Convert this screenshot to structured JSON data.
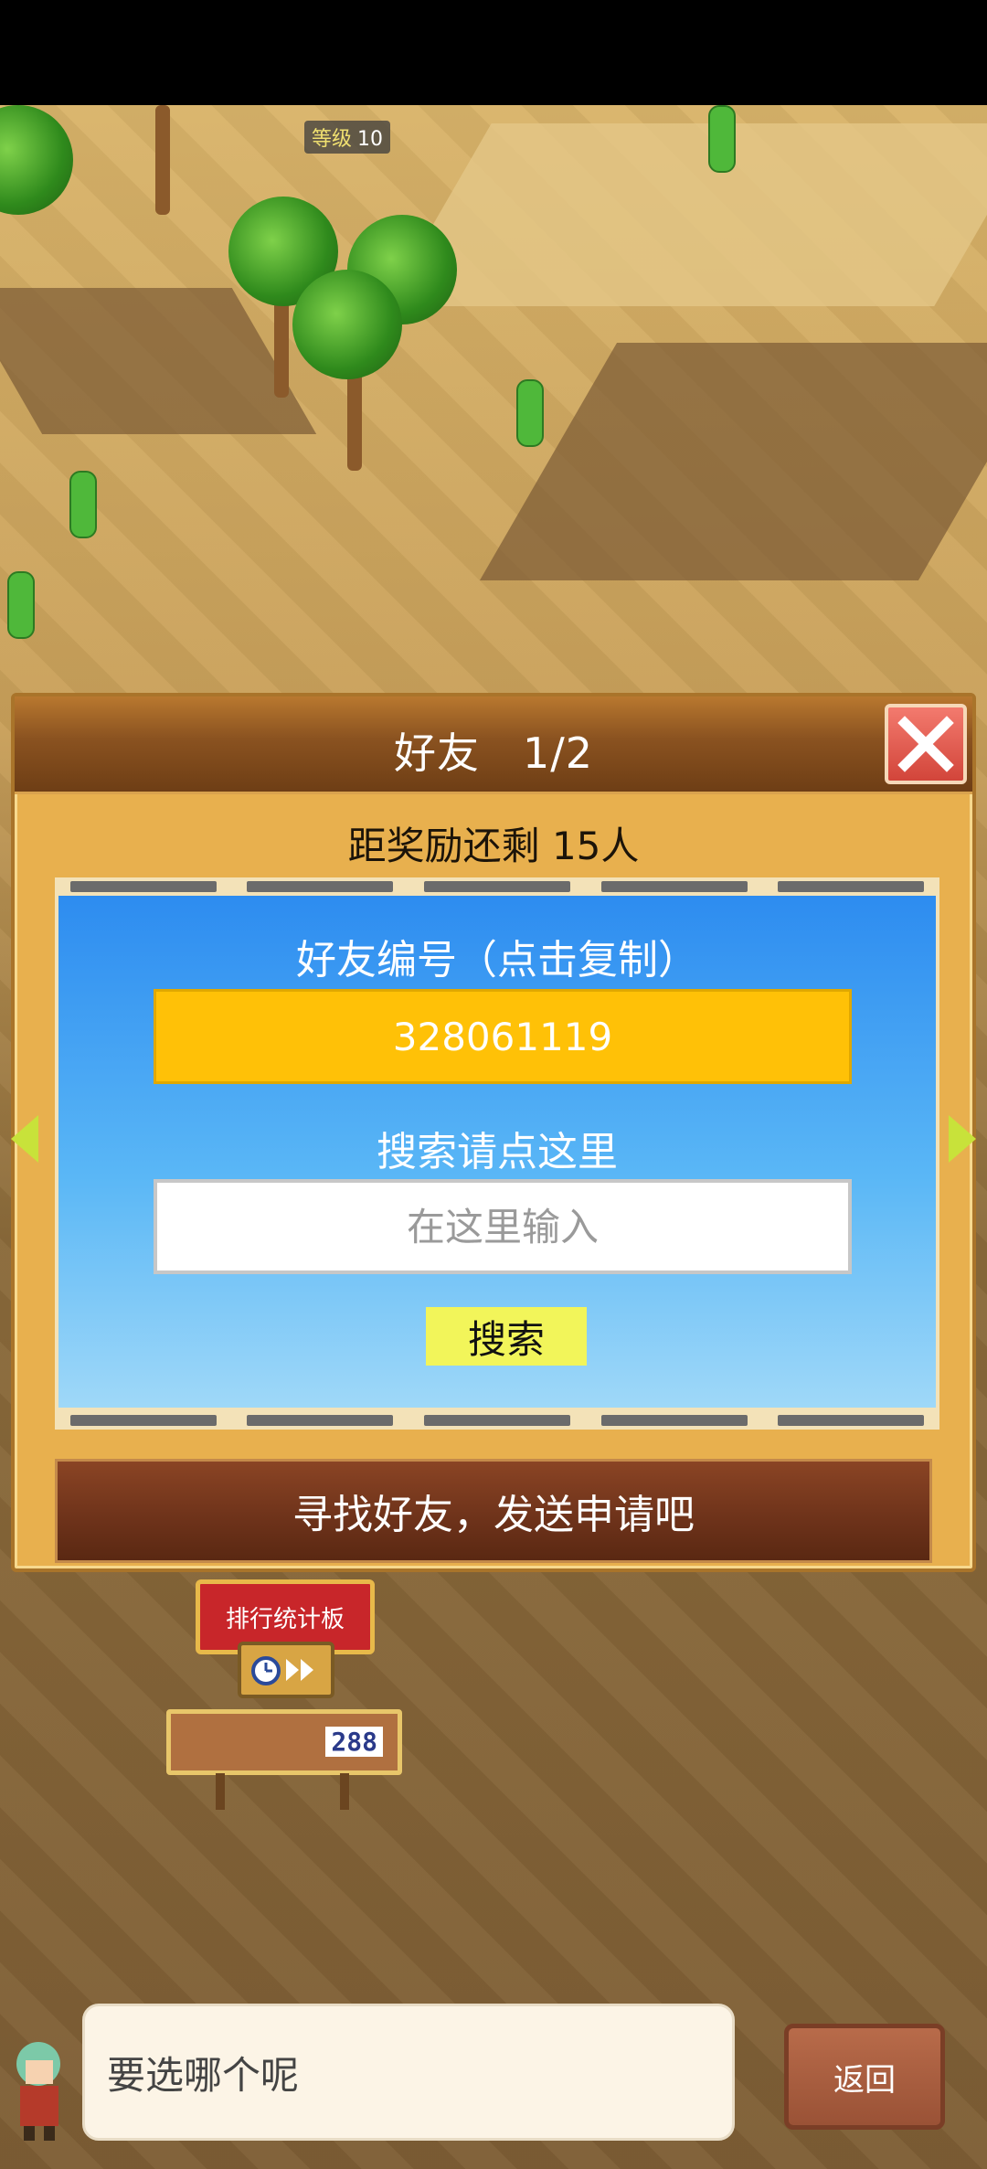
{
  "hud": {
    "level_label": "等级",
    "level_value": "10"
  },
  "dialog": {
    "title": "好友　1/2",
    "reward_text": "距奖励还剩 15人",
    "friend_id_label": "好友编号（点击复制）",
    "friend_id_value": "328061119",
    "search_label": "搜索请点这里",
    "search_placeholder": "在这里输入",
    "search_button": "搜索",
    "find_friends_button": "寻找好友，发送申请吧"
  },
  "scene": {
    "rank_sign": "排行统计板",
    "score_value": "288"
  },
  "footer": {
    "speech_text": "要选哪个呢",
    "back_button": "返回"
  },
  "colors": {
    "panel_blue": "#2d8cf0",
    "friend_id_bg": "#ffc107",
    "search_button_bg": "#f2f55a",
    "close_button": "#d2453a"
  }
}
